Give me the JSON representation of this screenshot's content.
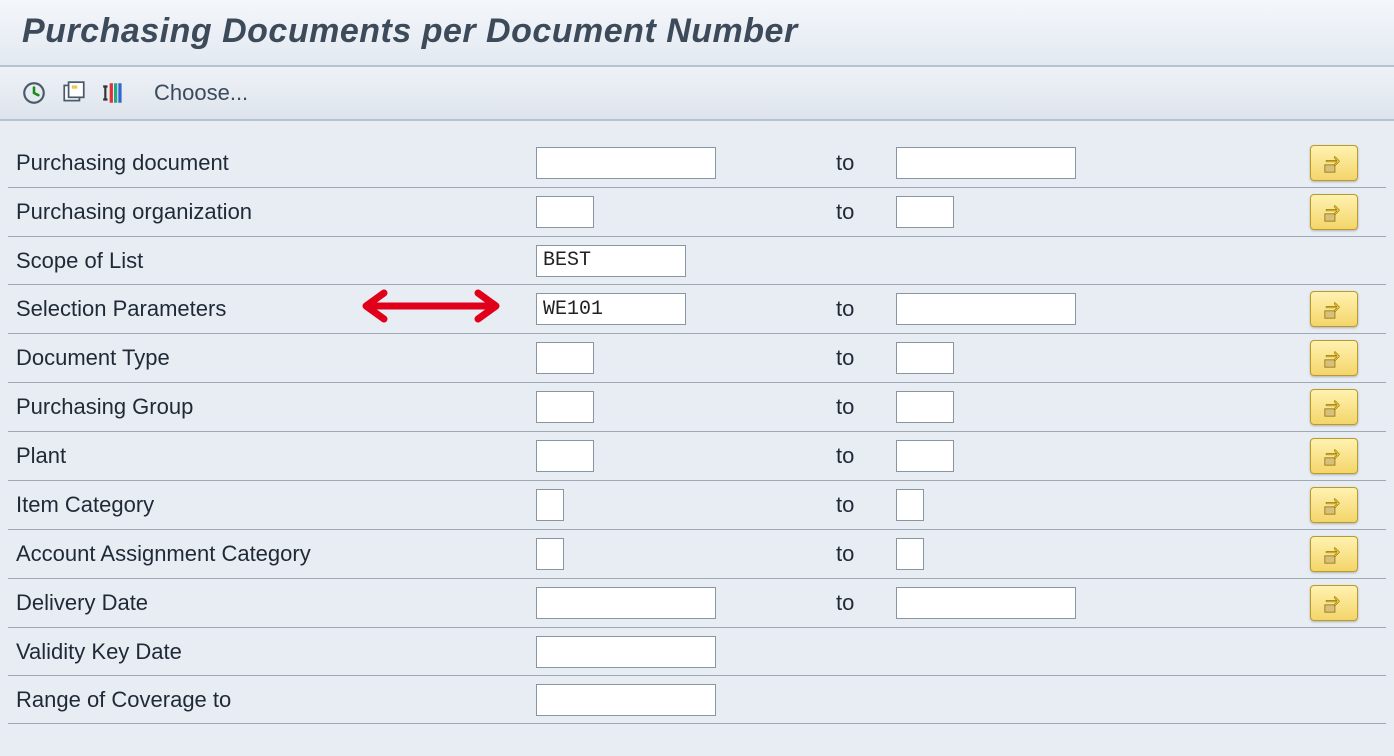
{
  "title": "Purchasing Documents per Document Number",
  "toolbar": {
    "choose_label": "Choose..."
  },
  "common": {
    "to_label": "to"
  },
  "rows": {
    "purchdoc": {
      "label": "Purchasing document",
      "from": "",
      "to": "",
      "has_range": true,
      "more": true,
      "from_w": "w-lg",
      "to_w": "w-lg"
    },
    "porg": {
      "label": "Purchasing organization",
      "from": "",
      "to": "",
      "has_range": true,
      "more": true,
      "from_w": "w-sm",
      "to_w": "w-sm"
    },
    "scope": {
      "label": "Scope of List",
      "from": "BEST",
      "has_range": false,
      "more": false,
      "from_w": "w-md"
    },
    "selparam": {
      "label": "Selection Parameters",
      "from": "WE101",
      "to": "",
      "has_range": true,
      "more": true,
      "from_w": "w-md",
      "to_w": "w-lg",
      "annot": true
    },
    "doctype": {
      "label": "Document Type",
      "from": "",
      "to": "",
      "has_range": true,
      "more": true,
      "from_w": "w-sm",
      "to_w": "w-sm"
    },
    "pgroup": {
      "label": "Purchasing Group",
      "from": "",
      "to": "",
      "has_range": true,
      "more": true,
      "from_w": "w-sm",
      "to_w": "w-sm"
    },
    "plant": {
      "label": "Plant",
      "from": "",
      "to": "",
      "has_range": true,
      "more": true,
      "from_w": "w-sm",
      "to_w": "w-sm"
    },
    "itemcat": {
      "label": "Item Category",
      "from": "",
      "to": "",
      "has_range": true,
      "more": true,
      "from_w": "w-xs",
      "to_w": "w-xs"
    },
    "acctasg": {
      "label": "Account Assignment Category",
      "from": "",
      "to": "",
      "has_range": true,
      "more": true,
      "from_w": "w-xs",
      "to_w": "w-xs"
    },
    "delivdate": {
      "label": "Delivery Date",
      "from": "",
      "to": "",
      "has_range": true,
      "more": true,
      "from_w": "w-lg",
      "to_w": "w-lg"
    },
    "valkey": {
      "label": "Validity Key Date",
      "from": "",
      "has_range": false,
      "more": false,
      "from_w": "w-lg"
    },
    "rangecov": {
      "label": "Range of Coverage to",
      "from": "",
      "has_range": false,
      "more": false,
      "from_w": "w-lg"
    }
  },
  "row_order": [
    "purchdoc",
    "porg",
    "scope",
    "selparam",
    "doctype",
    "pgroup",
    "plant",
    "itemcat",
    "acctasg",
    "delivdate",
    "valkey",
    "rangecov"
  ]
}
